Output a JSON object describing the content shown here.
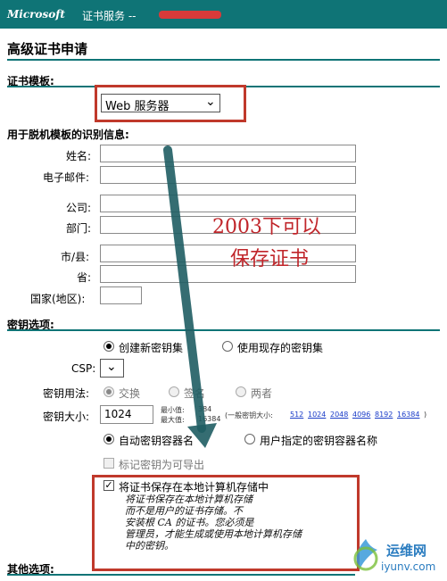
{
  "header": {
    "brand": "Microsoft",
    "service": "证书服务  --",
    "accent": "#0f7476"
  },
  "page_title": "高级证书申请",
  "template_section": {
    "heading": "证书模板:",
    "selected": "Web 服务器"
  },
  "identity_section": {
    "heading": "用于脱机模板的识别信息:",
    "fields": [
      {
        "label": "姓名:",
        "value": ""
      },
      {
        "label": "电子邮件:",
        "value": ""
      },
      {
        "label": "公司:",
        "value": ""
      },
      {
        "label": "部门:",
        "value": ""
      },
      {
        "label": "市/县:",
        "value": ""
      },
      {
        "label": "省:",
        "value": ""
      },
      {
        "label": "国家(地区):",
        "value": ""
      }
    ]
  },
  "annotation": {
    "line1": "2003下可以",
    "line2": "保存证书",
    "color": "#c0252a"
  },
  "key_section": {
    "heading": "密钥选项:",
    "new_keyset": "创建新密钥集",
    "existing_keyset": "使用现存的密钥集",
    "csp_label": "CSP:",
    "usage_label": "密钥用法:",
    "usage_options": [
      "交换",
      "签名",
      "两者"
    ],
    "usage_selected": "交换",
    "size_label": "密钥大小:",
    "size_value": "1024",
    "min_label": "最小值:",
    "min_value": "384",
    "max_label": "最大值:",
    "max_value": "16384",
    "common_sizes_label": "(一般密钥大小:",
    "common_sizes": [
      "512",
      "1024",
      "2048",
      "4096",
      "8192",
      "16384"
    ],
    "common_sizes_close": ")",
    "auto_container": "自动密钥容器名",
    "user_container": "用户指定的密钥容器名称",
    "exportable": "标记密钥为可导出",
    "store_local": "将证书保存在本地计算机存储中",
    "store_desc": [
      "将证书保存在本地计算机存储",
      "而不是用户的证书存储。不",
      "安装根 CA 的证书。您必须是",
      "管理员，才能生成或使用本地计算机存储",
      "中的密钥。"
    ]
  },
  "other_section": {
    "heading": "其他选项:"
  },
  "watermark": {
    "name": "运维网",
    "url": "iyunv.com"
  }
}
